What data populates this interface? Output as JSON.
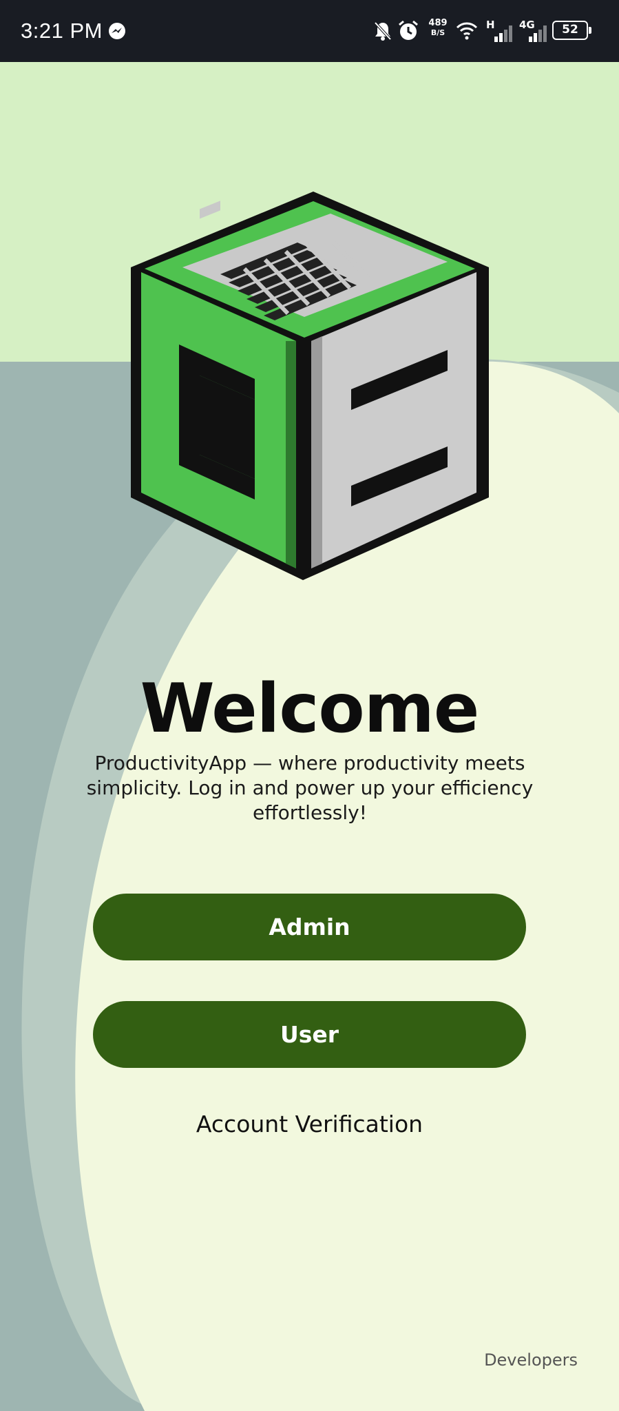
{
  "status_bar": {
    "time": "3:21 PM",
    "net_speed_value": "489",
    "net_speed_unit": "B/S",
    "signal_1_label": "H",
    "signal_2_label": "4G",
    "battery_level": "52",
    "icons": [
      "messenger-icon",
      "mute-icon",
      "alarm-icon",
      "wifi-icon",
      "signal-icon",
      "battery-icon"
    ]
  },
  "main": {
    "title": "Welcome",
    "tagline": "ProductivityApp — where productivity meets simplicity. Log in and power up your efficiency effortlessly!",
    "admin_button": "Admin",
    "user_button": "User",
    "verification_link": "Account Verification",
    "developers_link": "Developers"
  },
  "colors": {
    "status_bar": "#191c23",
    "top_background": "#d6f0c4",
    "main_background": "#f2f8de",
    "arc_outer": "#9eb5b1",
    "arc_inner": "#b8cbc2",
    "button": "#335f12",
    "logo_green": "#4fc24f",
    "logo_grey": "#cccccc"
  }
}
